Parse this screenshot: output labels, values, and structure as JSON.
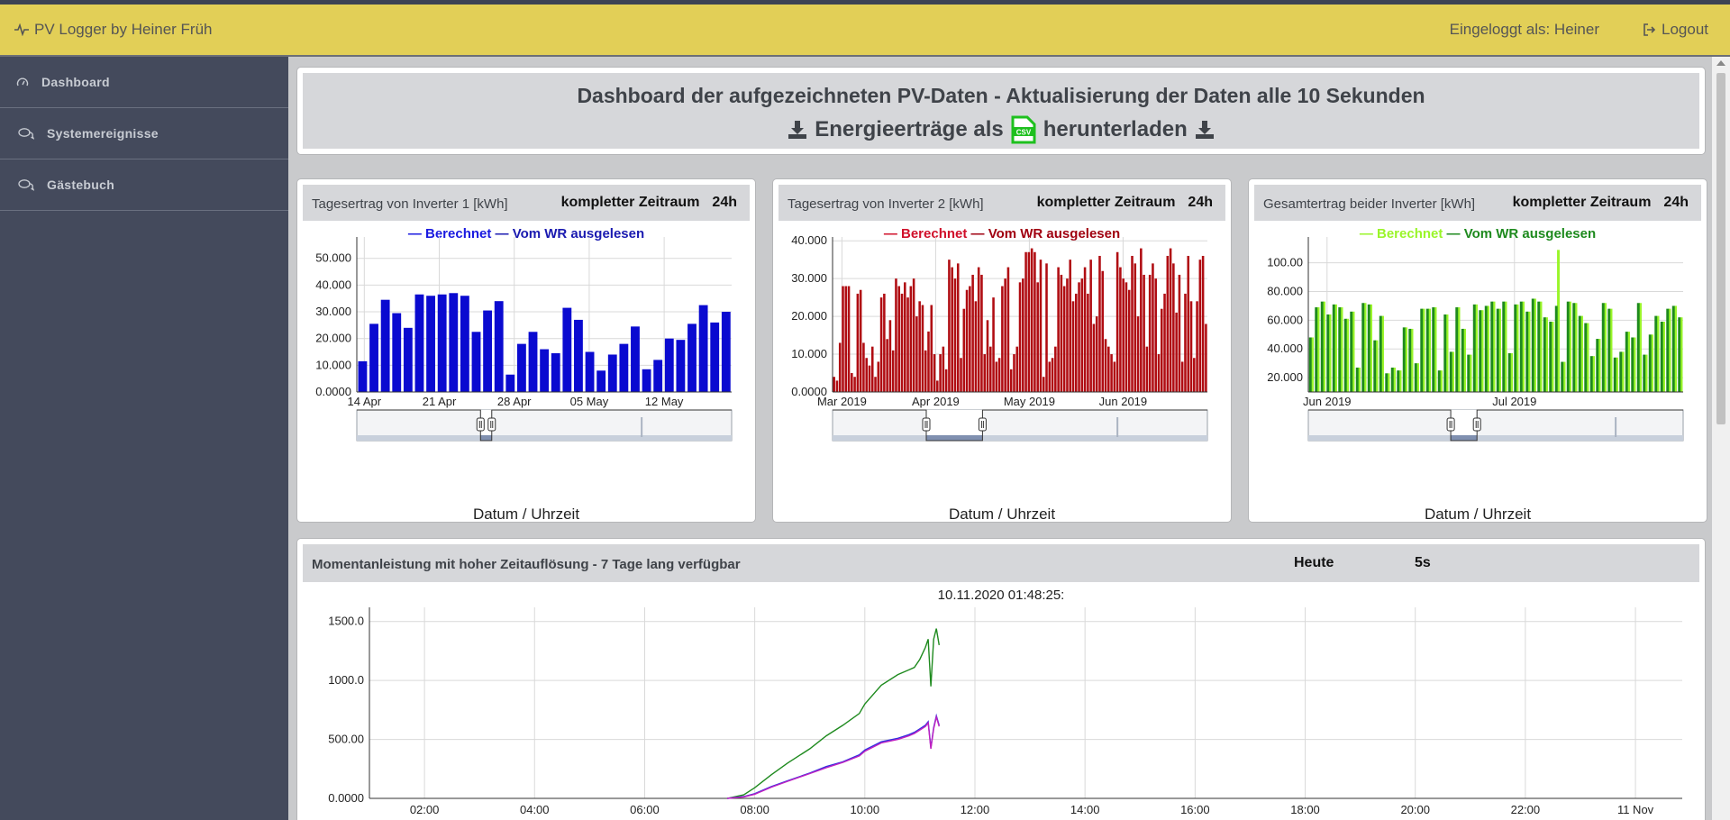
{
  "navbar": {
    "brand": "PV Logger by Heiner Früh",
    "user": "Eingeloggt als: Heiner",
    "logout": "Logout"
  },
  "sidebar": {
    "items": [
      {
        "label": "Dashboard",
        "icon": "dashboard-gauge-icon"
      },
      {
        "label": "Systemereignisse",
        "icon": "comments-icon"
      },
      {
        "label": "Gästebuch",
        "icon": "comments-icon"
      }
    ]
  },
  "header": {
    "title": "Dashboard der aufgezeichneten PV-Daten - Aktualisierung der Daten alle 10 Sekunden",
    "dl_left": "Energieerträge als",
    "dl_right": "herunterladen",
    "csv_badge": "CSV"
  },
  "charts": [
    {
      "title": "Tagesertrag von Inverter 1 [kWh]",
      "range_full": "kompletter Zeitraum",
      "range_24h": "24h",
      "legend": [
        {
          "label": "— Berechnet",
          "color": "#1a1ae0"
        },
        {
          "label": "— Vom WR ausgelesen",
          "color": "#1a1ab0"
        }
      ],
      "xtitle": "Datum / Uhrzeit"
    },
    {
      "title": "Tagesertrag von Inverter 2 [kWh]",
      "range_full": "kompletter Zeitraum",
      "range_24h": "24h",
      "legend": [
        {
          "label": "— Berechnet",
          "color": "#d0102a"
        },
        {
          "label": "— Vom WR ausgelesen",
          "color": "#a00010"
        }
      ],
      "xtitle": "Datum / Uhrzeit"
    },
    {
      "title": "Gesamtertrag beider Inverter [kWh]",
      "range_full": "kompletter Zeitraum",
      "range_24h": "24h",
      "legend": [
        {
          "label": "— Berechnet",
          "color": "#9af52a"
        },
        {
          "label": "— Vom WR ausgelesen",
          "color": "#1e8a1e"
        }
      ],
      "xtitle": "Datum / Uhrzeit"
    }
  ],
  "chart_data": [
    {
      "type": "bar",
      "title": "Tagesertrag von Inverter 1 [kWh]",
      "xlabel": "Datum / Uhrzeit",
      "ylim": [
        0,
        58
      ],
      "yticks": [
        "0.0000",
        "10.000",
        "20.000",
        "30.000",
        "40.000",
        "50.000"
      ],
      "xticks": [
        "14 Apr",
        "21 Apr",
        "28 Apr",
        "05 May",
        "12 May"
      ],
      "color": "#0a0ad0",
      "series": [
        {
          "name": "Vom WR ausgelesen",
          "values": [
            11.5,
            25.5,
            34.5,
            29.5,
            24,
            36.5,
            36,
            36.5,
            37,
            36,
            22.5,
            30.5,
            34,
            6.5,
            18,
            22.5,
            16,
            14.5,
            31.5,
            27,
            15,
            8,
            14,
            18,
            24.5,
            8.5,
            12,
            20,
            19.5,
            25.5,
            32.5,
            26,
            30
          ]
        }
      ]
    },
    {
      "type": "bar",
      "title": "Tagesertrag von Inverter 2 [kWh]",
      "xlabel": "Datum / Uhrzeit",
      "ylim": [
        0,
        41
      ],
      "yticks": [
        "0.0000",
        "10.000",
        "20.000",
        "30.000",
        "40.000"
      ],
      "xticks": [
        "Mar 2019",
        "Apr 2019",
        "May 2019",
        "Jun 2019"
      ],
      "color": "#b00c12",
      "series": [
        {
          "name": "Vom WR ausgelesen",
          "values": [
            4,
            3,
            13,
            28,
            28,
            28,
            5,
            4,
            26,
            27,
            13,
            9,
            7,
            12,
            4,
            8,
            25,
            26,
            14,
            19,
            11,
            30,
            28,
            26,
            29,
            25,
            28,
            30,
            20,
            24,
            23,
            11,
            16,
            23,
            10,
            3,
            10,
            12,
            6,
            35,
            33,
            30,
            34,
            9,
            22,
            27,
            28,
            31,
            24,
            33,
            31,
            10,
            19,
            12,
            25,
            8,
            9,
            28,
            30,
            33,
            6,
            10,
            12,
            29,
            30,
            37,
            37,
            38,
            37,
            29,
            35,
            4,
            34,
            8,
            9,
            12,
            33,
            31,
            28,
            30,
            35,
            24,
            26,
            29,
            30,
            33,
            26,
            35,
            18,
            20,
            36,
            32,
            14,
            12,
            10,
            8,
            37,
            33,
            30,
            29,
            27,
            36,
            34,
            20,
            38,
            31,
            12,
            31,
            34,
            30,
            10,
            22,
            26,
            36,
            38,
            34,
            21,
            31,
            8,
            26,
            36,
            24,
            9,
            24,
            35,
            36,
            18
          ]
        }
      ]
    },
    {
      "type": "bar",
      "title": "Gesamtertrag beider Inverter [kWh]",
      "xlabel": "Datum / Uhrzeit",
      "ylim": [
        10,
        118
      ],
      "yticks": [
        "20.000",
        "40.000",
        "60.000",
        "80.000",
        "100.00"
      ],
      "xticks": [
        "Jun 2019",
        "Jul 2019"
      ],
      "color": "#1e8a1e",
      "highlight_color": "#9af52a",
      "series": [
        {
          "name": "Vom WR ausgelesen",
          "values": [
            48,
            69,
            73,
            64,
            71,
            69,
            61,
            66,
            27,
            72,
            71,
            46,
            63,
            23,
            27,
            25,
            55,
            54,
            30,
            68,
            68,
            69,
            25,
            64,
            38,
            69,
            54,
            36,
            71,
            67,
            70,
            73,
            68,
            73,
            37,
            71,
            73,
            66,
            75,
            73,
            62,
            59,
            70,
            31,
            73,
            72,
            63,
            58,
            35,
            47,
            72,
            68,
            34,
            38,
            52,
            48,
            72,
            36,
            50,
            63,
            59,
            68,
            70,
            62
          ]
        },
        {
          "name": "Berechnet",
          "values": [
            48,
            69,
            73,
            64,
            71,
            69,
            61,
            66,
            27,
            72,
            71,
            46,
            63,
            23,
            27,
            25,
            55,
            54,
            30,
            68,
            68,
            69,
            25,
            64,
            38,
            69,
            54,
            36,
            71,
            67,
            70,
            73,
            68,
            73,
            37,
            71,
            73,
            66,
            75,
            73,
            62,
            59,
            109,
            31,
            73,
            72,
            63,
            58,
            35,
            47,
            72,
            68,
            34,
            38,
            52,
            48,
            72,
            36,
            50,
            63,
            59,
            68,
            70,
            62
          ]
        }
      ]
    },
    {
      "type": "line",
      "title": "Momentanleistung mit hoher Zeitauflösung - 7 Tage lang verfügbar",
      "ylim": [
        0,
        1620
      ],
      "yticks": [
        "0.0000",
        "500.00",
        "1000.0",
        "1500.0"
      ],
      "xticks": [
        "02:00",
        "04:00",
        "06:00",
        "08:00",
        "10:00",
        "12:00",
        "14:00",
        "16:00",
        "18:00",
        "20:00",
        "22:00",
        "11 Nov"
      ],
      "xlim_hours": [
        1,
        24.85
      ],
      "series": [
        {
          "name": "green",
          "color": "#1e8a1e",
          "x": [
            7.5,
            7.8,
            8.0,
            8.3,
            8.6,
            9.0,
            9.3,
            9.6,
            9.9,
            10.0,
            10.3,
            10.6,
            10.8,
            10.9,
            11.0,
            11.1,
            11.15,
            11.2,
            11.25,
            11.3,
            11.35
          ],
          "y": [
            0,
            30,
            90,
            200,
            300,
            420,
            530,
            620,
            720,
            800,
            960,
            1050,
            1090,
            1110,
            1180,
            1280,
            1350,
            950,
            1350,
            1440,
            1300
          ]
        },
        {
          "name": "blue",
          "color": "#3030e0",
          "x": [
            7.5,
            7.8,
            8.0,
            8.3,
            8.6,
            9.0,
            9.3,
            9.6,
            9.9,
            10.0,
            10.3,
            10.6,
            10.8,
            10.9,
            11.0,
            11.1,
            11.15,
            11.2,
            11.25,
            11.3,
            11.35
          ],
          "y": [
            0,
            15,
            40,
            100,
            150,
            215,
            270,
            310,
            370,
            410,
            480,
            510,
            540,
            560,
            590,
            620,
            650,
            430,
            600,
            700,
            620
          ]
        },
        {
          "name": "magenta",
          "color": "#c020c0",
          "x": [
            7.5,
            7.8,
            8.0,
            8.3,
            8.6,
            9.0,
            9.3,
            9.6,
            9.9,
            10.0,
            10.3,
            10.6,
            10.8,
            10.9,
            11.0,
            11.1,
            11.15,
            11.2,
            11.25,
            11.3,
            11.35
          ],
          "y": [
            0,
            12,
            35,
            95,
            145,
            210,
            260,
            305,
            360,
            400,
            470,
            500,
            530,
            550,
            580,
            610,
            640,
            420,
            590,
            690,
            610
          ]
        }
      ]
    }
  ],
  "live": {
    "title": "Momentanleistung mit hoher Zeitauflösung - 7 Tage lang verfügbar",
    "today": "Heute",
    "resolution": "5s",
    "timestamp": "10.11.2020 01:48:25:"
  }
}
